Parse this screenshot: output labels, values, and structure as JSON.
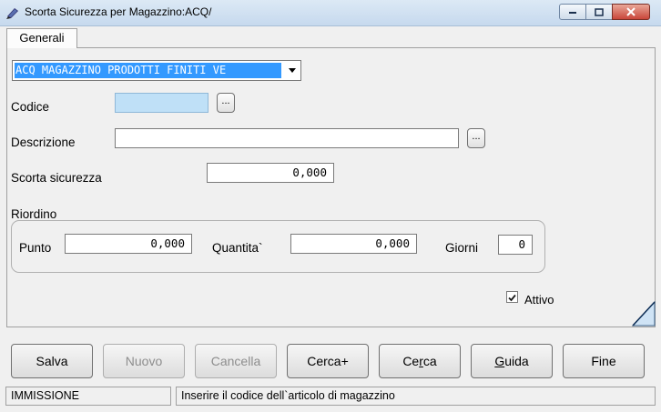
{
  "window": {
    "title": "Scorta Sicurezza per Magazzino:ACQ/"
  },
  "tabs": [
    {
      "label": "Generali"
    }
  ],
  "warehouse_combo": {
    "selected": "ACQ MAGAZZINO PRODOTTI FINITI VE"
  },
  "form": {
    "codice": {
      "label": "Codice",
      "value": ""
    },
    "descrizione": {
      "label": "Descrizione",
      "value": ""
    },
    "scorta": {
      "label": "Scorta sicurezza",
      "value": "0,000"
    },
    "riordino": {
      "label": "Riordino",
      "punto": {
        "label": "Punto",
        "value": "0,000"
      },
      "quantita": {
        "label": "Quantita`",
        "value": "0,000"
      },
      "giorni": {
        "label": "Giorni",
        "value": "0"
      }
    },
    "attivo": {
      "label": "Attivo",
      "checked": true
    },
    "lookup_label": "..."
  },
  "buttons": {
    "salva": "Salva",
    "nuovo": "Nuovo",
    "cancella": "Cancella",
    "cerca_plus": "Cerca+",
    "cerca_pre": "Ce",
    "cerca_key": "r",
    "cerca_post": "ca",
    "guida_key": "G",
    "guida_post": "uida",
    "fine": "Fine"
  },
  "status": {
    "mode": "IMMISSIONE",
    "message": "Inserire il codice dell`articolo di magazzino"
  }
}
